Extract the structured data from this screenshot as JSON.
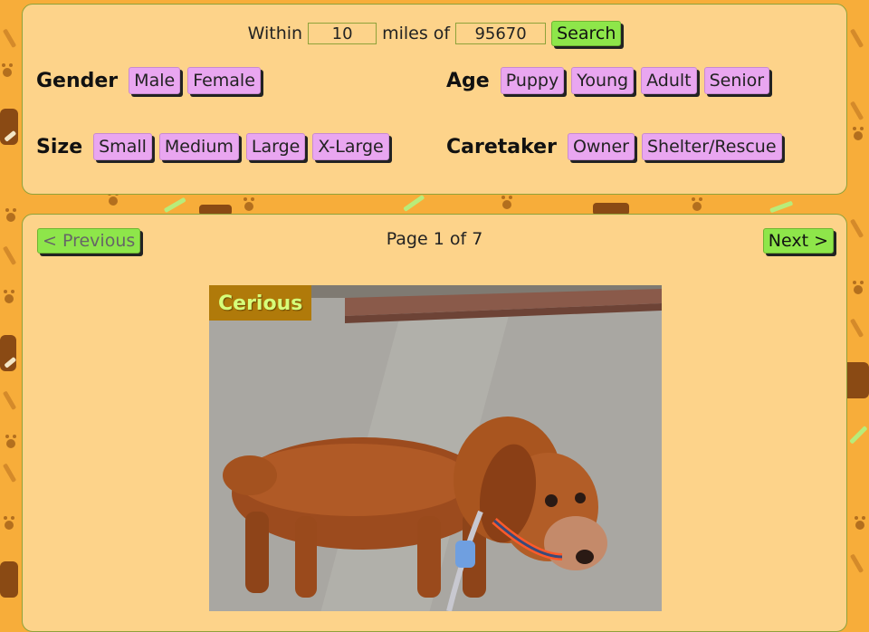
{
  "search": {
    "within_label": "Within",
    "distance_value": "10",
    "miles_label": "miles of",
    "zip_value": "95670",
    "search_button": "Search"
  },
  "filters": {
    "gender": {
      "label": "Gender",
      "options": [
        "Male",
        "Female"
      ]
    },
    "age": {
      "label": "Age",
      "options": [
        "Puppy",
        "Young",
        "Adult",
        "Senior"
      ]
    },
    "size": {
      "label": "Size",
      "options": [
        "Small",
        "Medium",
        "Large",
        "X-Large"
      ]
    },
    "caretaker": {
      "label": "Caretaker",
      "options": [
        "Owner",
        "Shelter/Rescue"
      ]
    }
  },
  "pagination": {
    "previous_label": "< Previous",
    "page_text": "Page 1 of 7",
    "next_label": "Next >"
  },
  "pet": {
    "name": "Cerious"
  },
  "colors": {
    "background": "#f7ad3a",
    "panel": "#fdd38a",
    "chip": "#e9a6f0",
    "button": "#8ee64a",
    "name_banner": "#b07a0a"
  }
}
